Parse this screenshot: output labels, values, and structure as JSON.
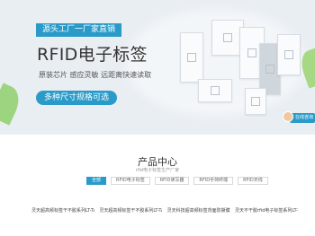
{
  "banner": {
    "ribbon": "源头工厂一厂家直销",
    "headline": "RFID电子标签",
    "features": "原装芯片   感应灵敏   远距离快速读取",
    "cta": "多种尺寸规格可选"
  },
  "chat_widget": {
    "label": "在线咨询"
  },
  "section": {
    "title": "产品中心",
    "subtitle": "rfid电子标签生产厂家",
    "tabs": [
      {
        "label": "全部",
        "active": true
      },
      {
        "label": "RFID电子标签"
      },
      {
        "label": "RFID读写器"
      },
      {
        "label": "RFID手持终端"
      },
      {
        "label": "RFID天线"
      }
    ]
  },
  "products": [
    {
      "name": "灵天超高频标签干不胶系列LT-TAG702..."
    },
    {
      "name": "灵天超高频标签干不胶系列LT-TAG702..."
    },
    {
      "name": "灵天科技超高频标签背面防撕膜..."
    },
    {
      "name": "灵天不干胶rfid电子标签系列LT-TAG20..."
    }
  ],
  "colors": {
    "accent": "#2a9bc9",
    "banner_bg": "#e9eef3"
  }
}
